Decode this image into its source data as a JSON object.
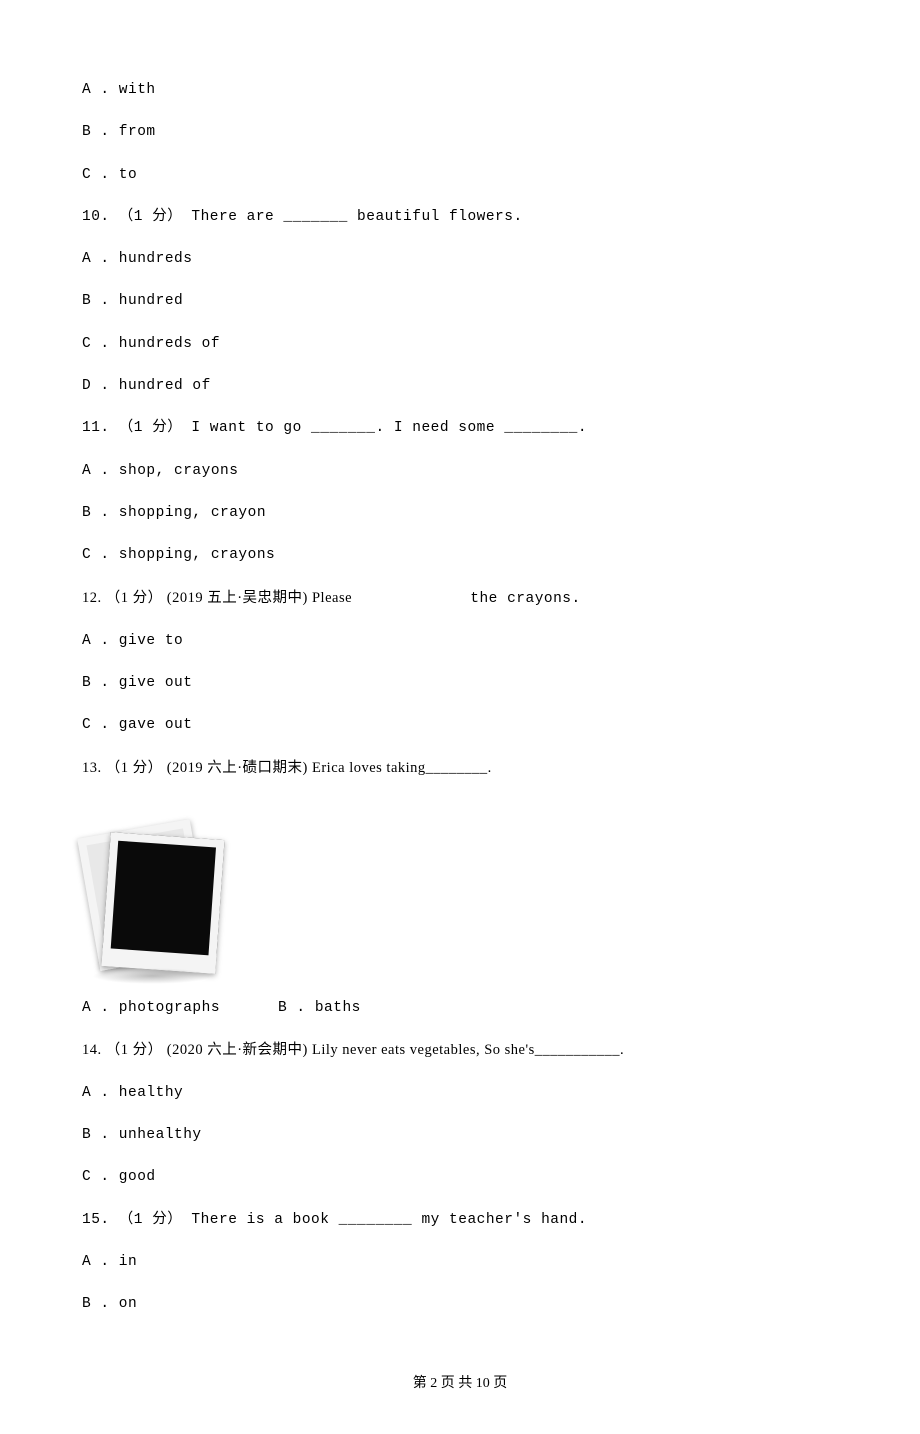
{
  "q9": {
    "a": "A . with",
    "b": "B . from",
    "c": "C . to"
  },
  "q10": {
    "stem": "10. （1 分） There are _______ beautiful flowers.",
    "a": "A . hundreds",
    "b": "B . hundred",
    "c": "C . hundreds of",
    "d": "D . hundred of"
  },
  "q11": {
    "stem": "11. （1 分） I want to go _______. I need some ________.",
    "a": "A . shop, crayons",
    "b": "B . shopping, crayon",
    "c": "C . shopping, crayons"
  },
  "q12": {
    "stem_pre": "12. （1 分） (2019 五上·吴忠期中) Please",
    "stem_post": "the crayons.",
    "a": "A . give to",
    "b": "B . give out",
    "c": "C . gave out"
  },
  "q13": {
    "stem": "13. （1 分） (2019 六上·碛口期末) Erica loves taking________.",
    "a": "A . photographs",
    "b": "B . baths"
  },
  "q14": {
    "stem": "14. （1 分） (2020 六上·新会期中) Lily never eats vegetables, So she's___________.",
    "a": "A . healthy",
    "b": "B . unhealthy",
    "c": "C . good"
  },
  "q15": {
    "stem": "15. （1 分） There is a book ________ my teacher's hand.",
    "a": "A . in",
    "b": "B . on"
  },
  "footer": "第 2 页 共 10 页"
}
